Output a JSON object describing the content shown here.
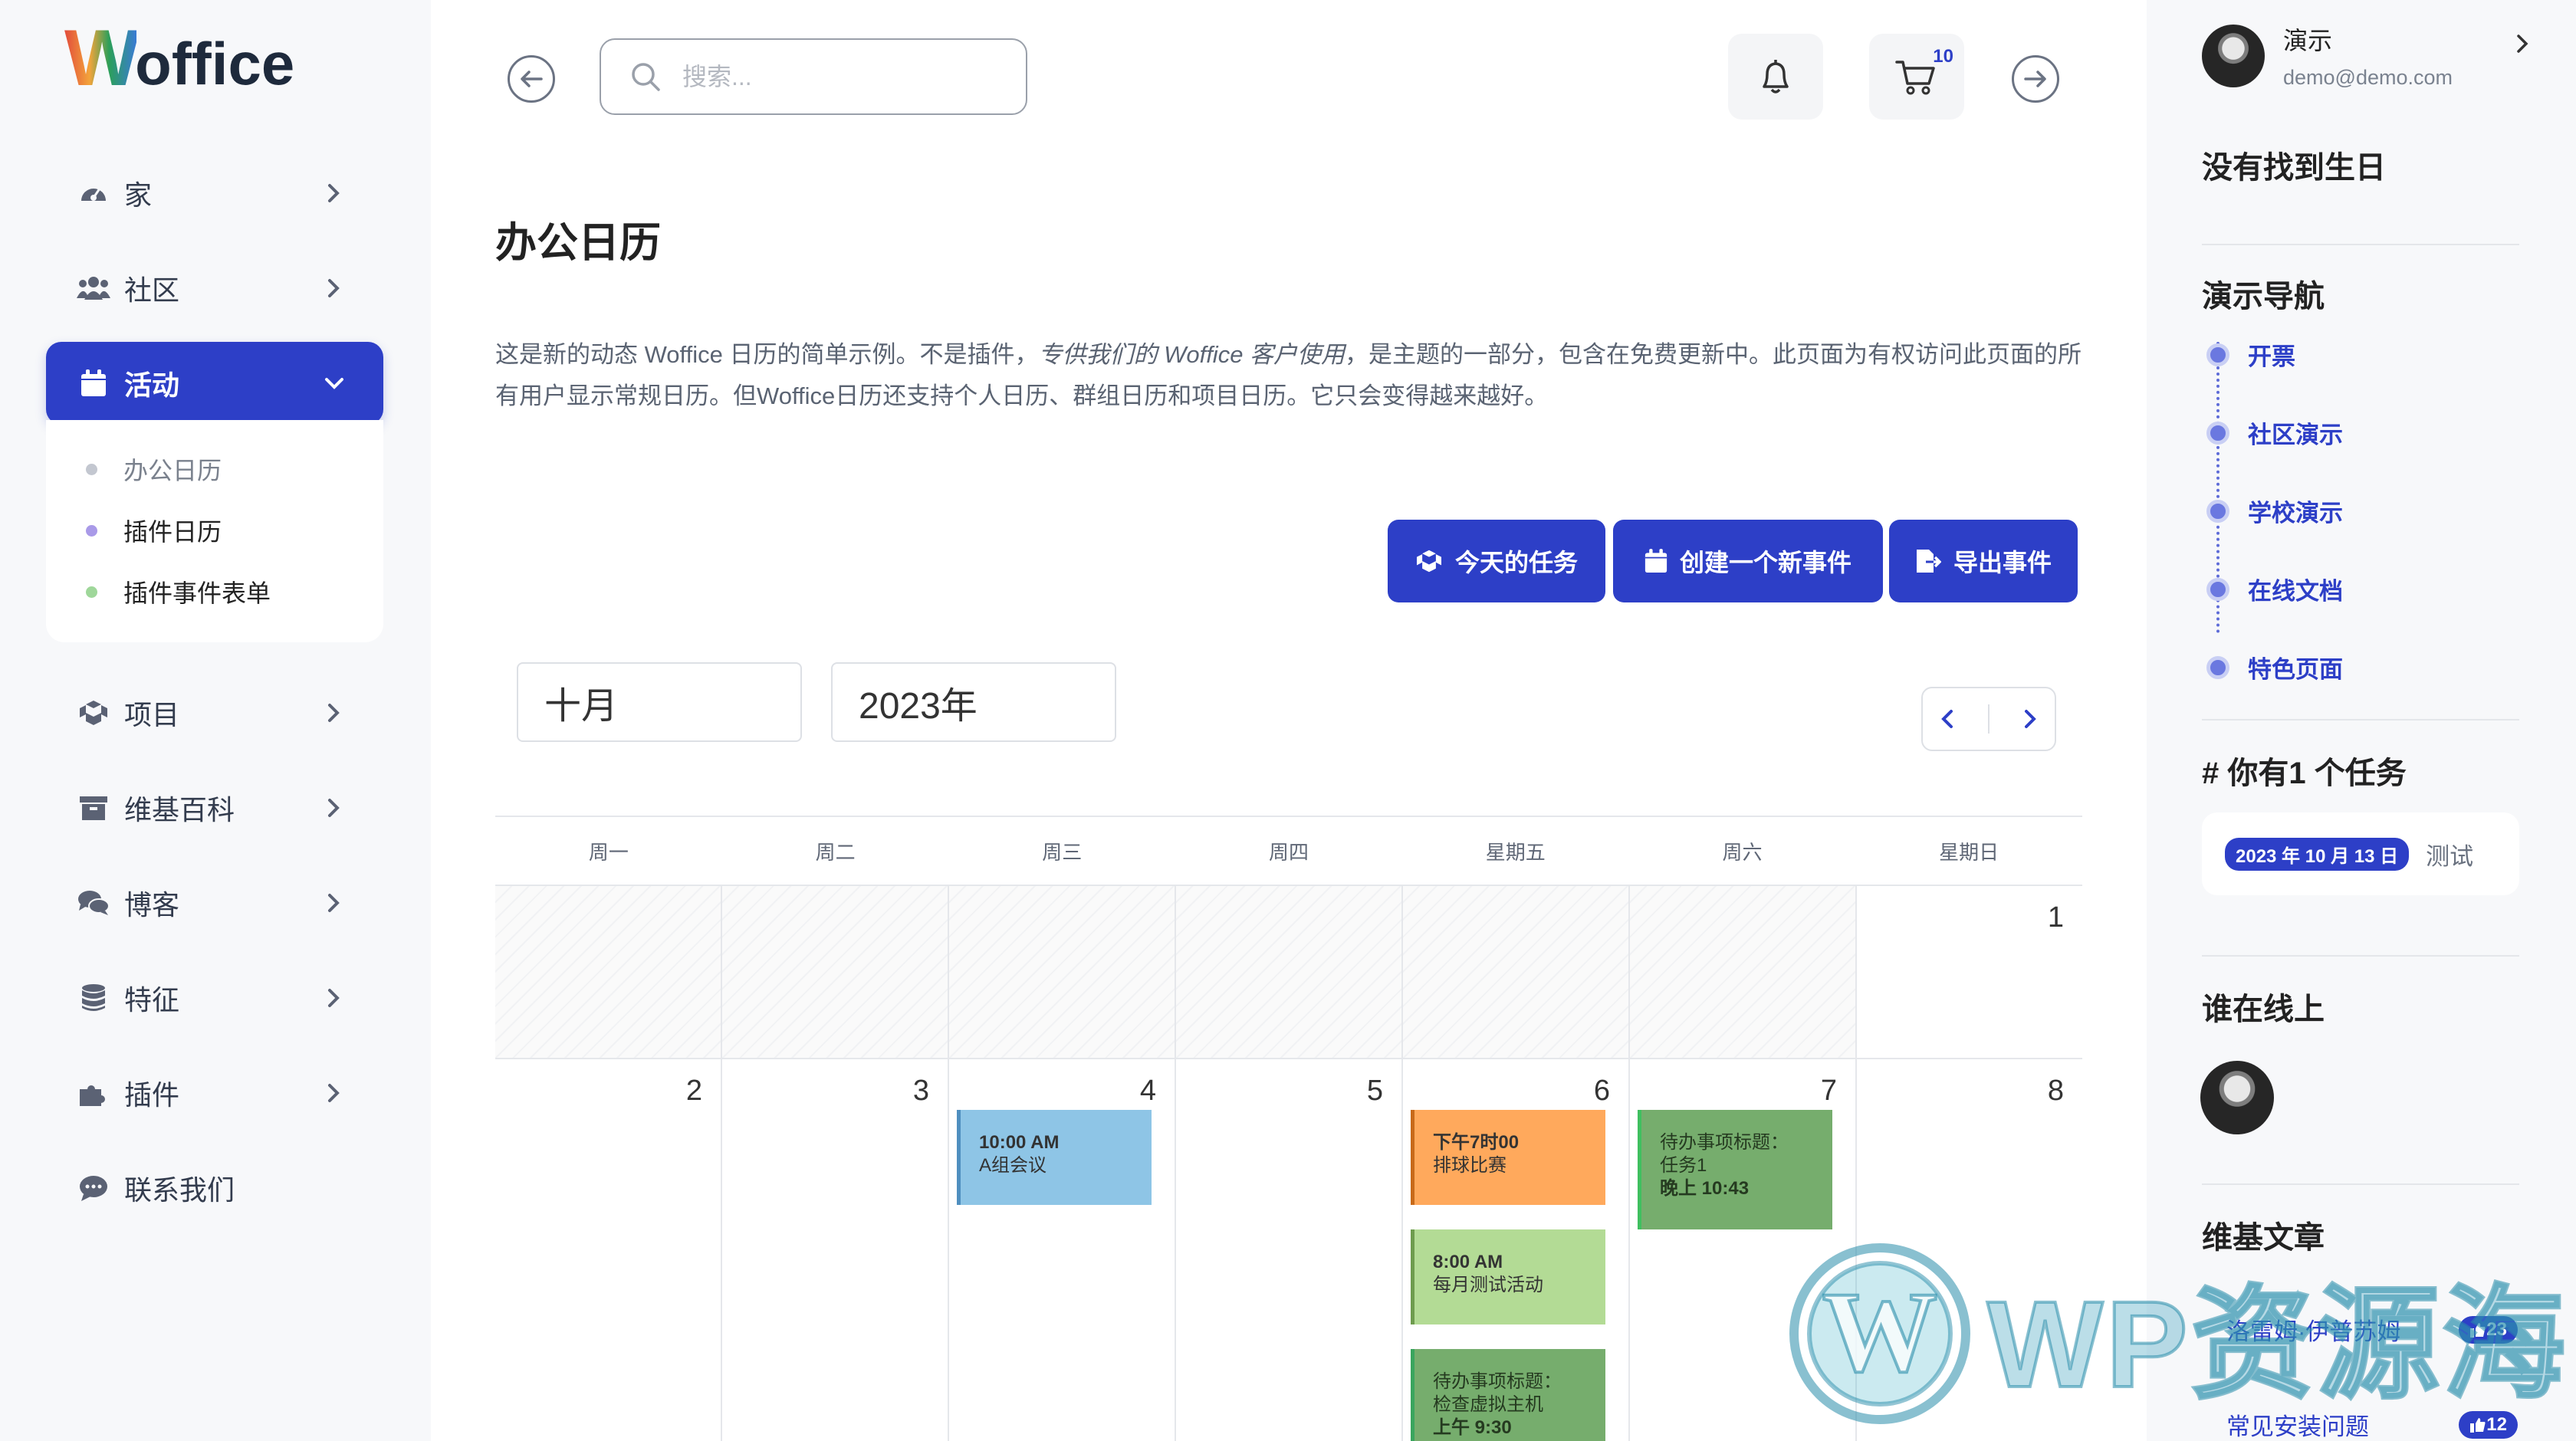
{
  "logo": {
    "w": "W",
    "rest": "office"
  },
  "sidebar": {
    "items": [
      {
        "label": "家",
        "icon": "dashboard-icon"
      },
      {
        "label": "社区",
        "icon": "users-icon"
      },
      {
        "label": "活动",
        "icon": "calendar-icon",
        "active": true
      },
      {
        "label": "项目",
        "icon": "cubes-icon"
      },
      {
        "label": "维基百科",
        "icon": "archive-icon"
      },
      {
        "label": "博客",
        "icon": "comments-icon"
      },
      {
        "label": "特征",
        "icon": "database-icon"
      },
      {
        "label": "插件",
        "icon": "puzzle-icon"
      },
      {
        "label": "联系我们",
        "icon": "chat-icon"
      }
    ],
    "submenu": [
      {
        "label": "办公日历",
        "dot_color": "#c3c7d0"
      },
      {
        "label": "插件日历",
        "dot_color": "#a99ae8"
      },
      {
        "label": "插件事件表单",
        "dot_color": "#9fd79a"
      }
    ]
  },
  "header": {
    "search_placeholder": "搜索...",
    "cart_count": "10"
  },
  "main": {
    "title": "办公日历",
    "intro_part1": "这是新的动态 Woffice 日历的简单示例。不是插件，",
    "intro_em": "专供我们的 Woffice 客户使用",
    "intro_part2": "，是主题的一部分，包含在免费更新中。此页面为有权访问此页面的所有用户显示常规日历。但Woffice日历还支持个人日历、群组日历和项目日历。它只会变得越来越好。",
    "buttons": {
      "today_tasks": "今天的任务",
      "new_event": "创建一个新事件",
      "export": "导出事件"
    },
    "month": "十月",
    "year": "2023年"
  },
  "calendar": {
    "weekdays": [
      "周一",
      "周二",
      "周三",
      "周四",
      "星期五",
      "周六",
      "星期日"
    ],
    "week1_day": "1",
    "week2_days": [
      "2",
      "3",
      "4",
      "5",
      "6",
      "7",
      "8"
    ],
    "events": [
      {
        "time": "10:00 AM",
        "title": "A组会议",
        "color": "#8ec5e6",
        "border": "#4f8fbf"
      },
      {
        "time": "下午7时00",
        "title": "排球比赛",
        "color": "#ffa95c",
        "border": "#c86a1a"
      },
      {
        "time": "8:00 AM",
        "title": "每月测试活动",
        "color": "#b3db95",
        "border": "#6e9c4e"
      },
      {
        "line1": "待办事项标题：",
        "line2": "检查虚拟主机",
        "time": "上午 9:30",
        "color": "#76ad6d",
        "border": "#3aa55e"
      },
      {
        "line1": "待办事项标题：",
        "line2": "任务1",
        "time": "晚上 10:43",
        "color": "#76ad6d",
        "border": "#3fbf5f"
      }
    ]
  },
  "right": {
    "user_name": "演示",
    "user_email": "demo@demo.com",
    "no_birthday": "没有找到生日",
    "demo_nav_title": "演示导航",
    "demo_nav": [
      "开票",
      "社区演示",
      "学校演示",
      "在线文档",
      "特色页面"
    ],
    "tasks_title": "# 你有1 个任务",
    "task_date": "2023 年 10 月 13 日",
    "task_text": "测试",
    "online_title": "谁在线上",
    "wiki_title": "维基文章",
    "wiki_items": [
      {
        "label": "洛雷姆·伊普苏姆",
        "count": "23"
      },
      {
        "label": "常见安装问题",
        "count": "12"
      }
    ]
  },
  "watermark": "WP资源海",
  "colors": {
    "accent": "#2d3fc7",
    "logo_w": [
      "#e24b3b",
      "#f3a43b",
      "#2c9f5a",
      "#3a7bd5"
    ]
  }
}
